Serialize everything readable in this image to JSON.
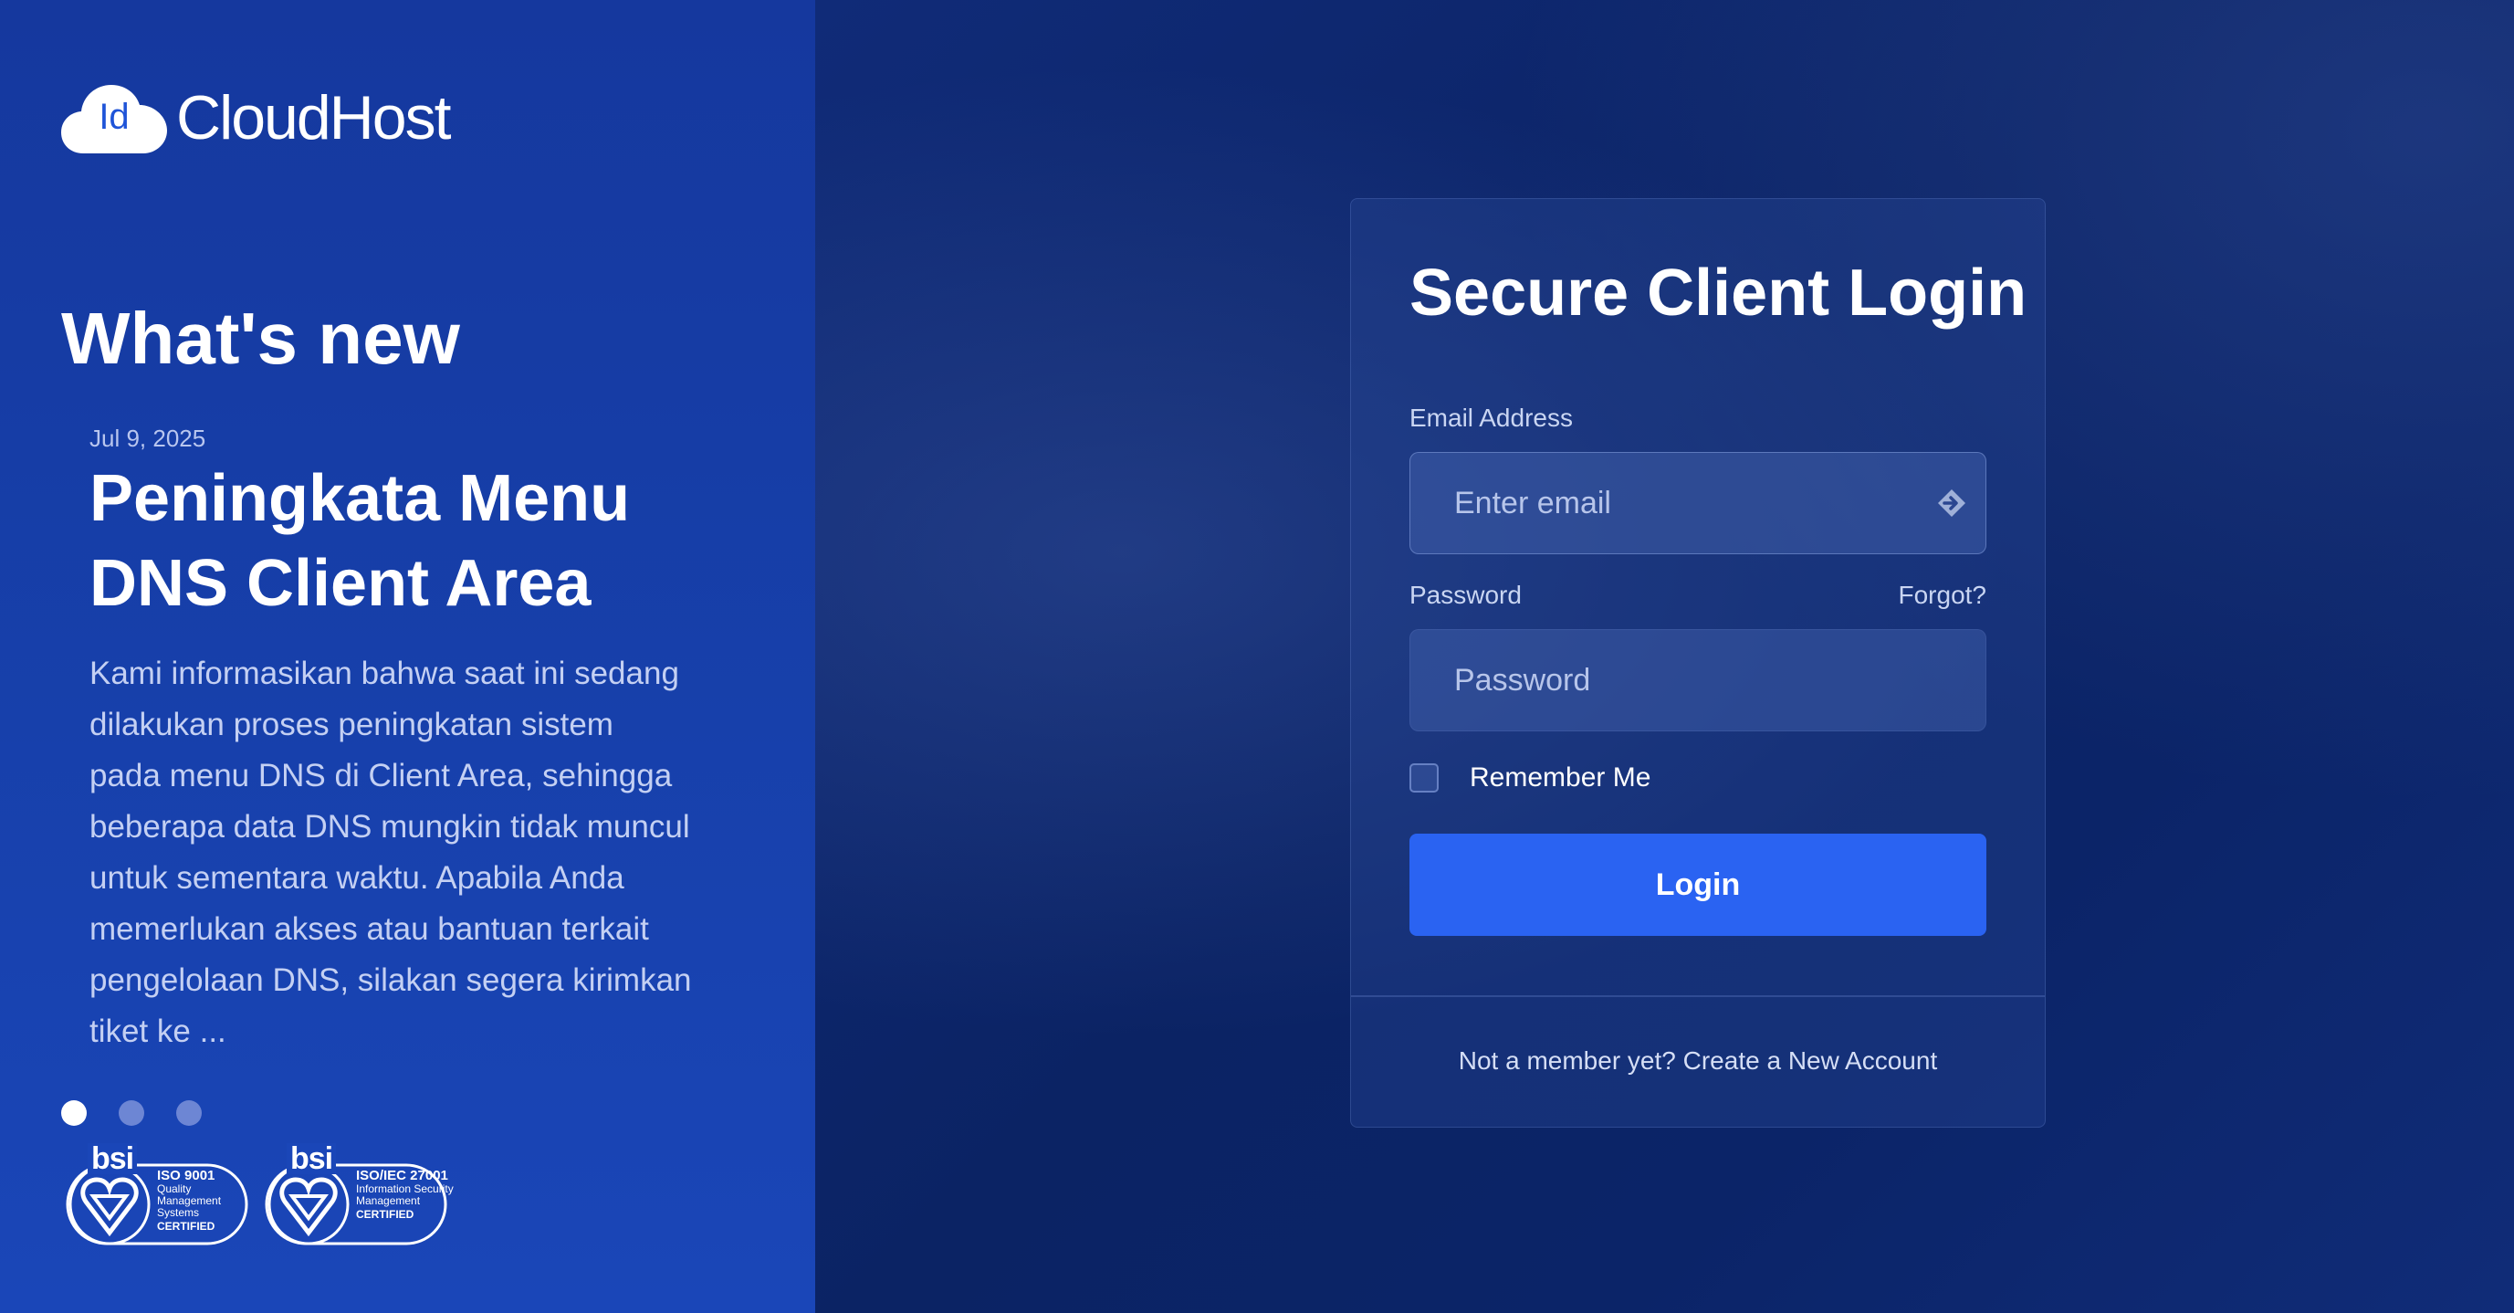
{
  "brand": {
    "logo_mark": "Id",
    "name": "CloudHost"
  },
  "news": {
    "heading": "What's new",
    "date": "Jul 9, 2025",
    "title": "Peningkata Menu DNS Client Area",
    "body": "Kami informasikan bahwa saat ini sedang dilakukan proses peningkatan sistem pada menu DNS di Client Area, sehingga beberapa data DNS mungkin tidak muncul untuk sementara waktu. Apabila Anda memerlukan akses atau bantuan terkait pengelolaan DNS, silakan segera kirimkan tiket ke ...",
    "slides": 3,
    "active_slide": 1
  },
  "certifications": [
    {
      "mark": "bsi",
      "standard": "ISO 9001",
      "lines": [
        "Quality",
        "Management",
        "Systems"
      ],
      "status": "CERTIFIED"
    },
    {
      "mark": "bsi",
      "standard": "ISO/IEC 27001",
      "lines": [
        "Information Security",
        "Management"
      ],
      "status": "CERTIFIED"
    }
  ],
  "login": {
    "title": "Secure Client Login",
    "email_label": "Email Address",
    "email_placeholder": "Enter email",
    "password_label": "Password",
    "password_placeholder": "Password",
    "forgot_label": "Forgot?",
    "remember_label": "Remember Me",
    "submit_label": "Login",
    "signup_prompt": "Not a member yet?",
    "signup_link": "Create a New Account"
  },
  "colors": {
    "left_panel": "#1740ab",
    "right_panel": "#0b2364",
    "accent": "#2a63f2",
    "logo_mark": "#1f54d8"
  },
  "icons": {
    "logo": "cloud-icon",
    "email_autofill": "autofill-key-icon",
    "certification": "bsi-kitemark-icon"
  }
}
